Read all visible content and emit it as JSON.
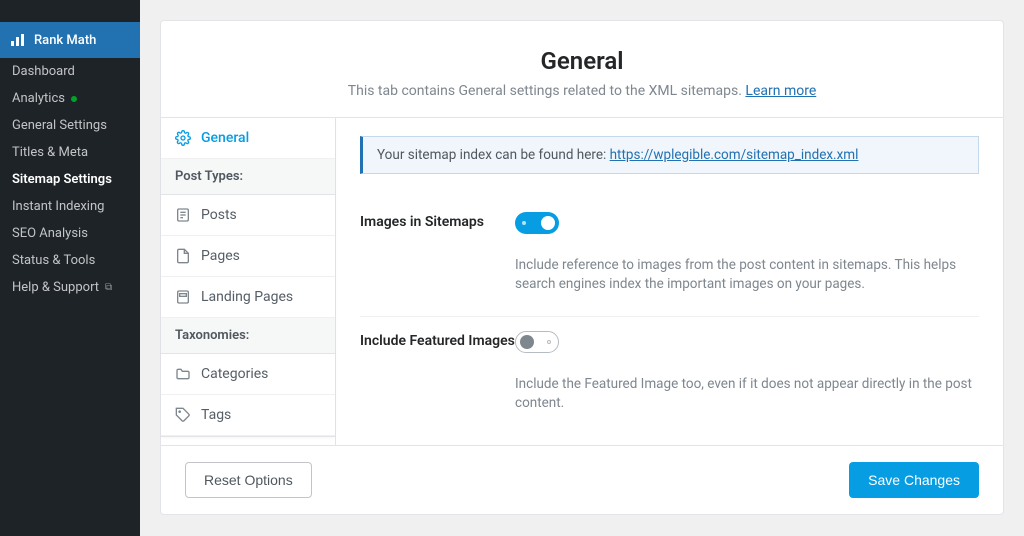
{
  "wp_sidebar": {
    "plugin": "Rank Math",
    "items": [
      {
        "label": "Dashboard"
      },
      {
        "label": "Analytics",
        "dot": true
      },
      {
        "label": "General Settings"
      },
      {
        "label": "Titles & Meta"
      },
      {
        "label": "Sitemap Settings",
        "active": true
      },
      {
        "label": "Instant Indexing"
      },
      {
        "label": "SEO Analysis"
      },
      {
        "label": "Status & Tools"
      },
      {
        "label": "Help & Support",
        "ext": true
      }
    ]
  },
  "header": {
    "title": "General",
    "subtitle": "This tab contains General settings related to the XML sitemaps.",
    "learn_more": "Learn more"
  },
  "nav": {
    "general": "General",
    "post_types_heading": "Post Types:",
    "posts": "Posts",
    "pages": "Pages",
    "landing": "Landing Pages",
    "tax_heading": "Taxonomies:",
    "categories": "Categories",
    "tags": "Tags"
  },
  "notice": {
    "prefix": "Your sitemap index can be found here: ",
    "url": "https://wplegible.com/sitemap_index.xml"
  },
  "settings": {
    "images": {
      "label": "Images in Sitemaps",
      "desc": "Include reference to images from the post content in sitemaps. This helps search engines index the important images on your pages."
    },
    "featured": {
      "label": "Include Featured Images",
      "desc": "Include the Featured Image too, even if it does not appear directly in the post content."
    }
  },
  "footer": {
    "reset": "Reset Options",
    "save": "Save Changes"
  }
}
